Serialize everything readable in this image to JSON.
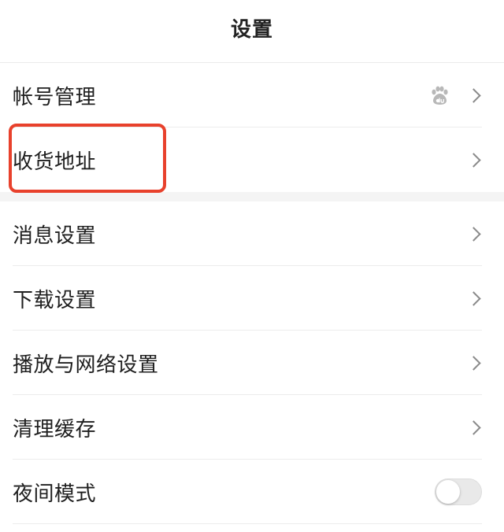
{
  "header": {
    "title": "设置"
  },
  "groups": [
    {
      "items": [
        {
          "label": "帐号管理",
          "trailing": [
            "baidu-icon",
            "chevron-right-icon"
          ]
        },
        {
          "label": "收货地址",
          "trailing": [
            "chevron-right-icon"
          ],
          "highlighted": true
        }
      ]
    },
    {
      "items": [
        {
          "label": "消息设置",
          "trailing": [
            "chevron-right-icon"
          ]
        },
        {
          "label": "下载设置",
          "trailing": [
            "chevron-right-icon"
          ]
        },
        {
          "label": "播放与网络设置",
          "trailing": [
            "chevron-right-icon"
          ]
        },
        {
          "label": "清理缓存",
          "trailing": [
            "chevron-right-icon"
          ]
        },
        {
          "label": "夜间模式",
          "trailing": [
            "toggle"
          ],
          "toggle_on": false
        }
      ]
    }
  ],
  "colors": {
    "highlight": "#e8412c",
    "divider": "#ececec",
    "section_background": "#f4f4f4",
    "chevron": "#8a8a8a"
  }
}
